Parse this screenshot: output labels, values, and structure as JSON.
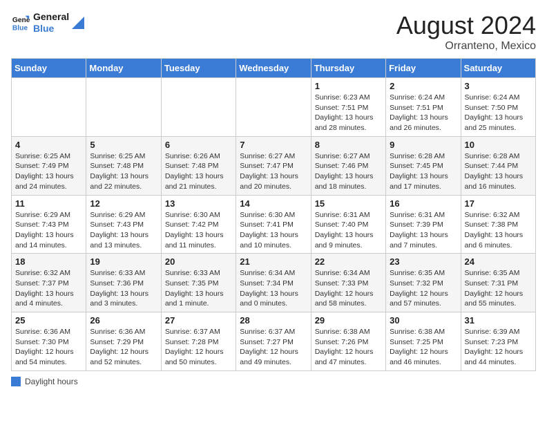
{
  "header": {
    "logo_general": "General",
    "logo_blue": "Blue",
    "month_year": "August 2024",
    "location": "Orranteno, Mexico"
  },
  "days_of_week": [
    "Sunday",
    "Monday",
    "Tuesday",
    "Wednesday",
    "Thursday",
    "Friday",
    "Saturday"
  ],
  "weeks": [
    {
      "days": [
        {
          "num": "",
          "info": ""
        },
        {
          "num": "",
          "info": ""
        },
        {
          "num": "",
          "info": ""
        },
        {
          "num": "",
          "info": ""
        },
        {
          "num": "1",
          "sunrise": "6:23 AM",
          "sunset": "7:51 PM",
          "daylight": "13 hours and 28 minutes."
        },
        {
          "num": "2",
          "sunrise": "6:24 AM",
          "sunset": "7:51 PM",
          "daylight": "13 hours and 26 minutes."
        },
        {
          "num": "3",
          "sunrise": "6:24 AM",
          "sunset": "7:50 PM",
          "daylight": "13 hours and 25 minutes."
        }
      ]
    },
    {
      "days": [
        {
          "num": "4",
          "sunrise": "6:25 AM",
          "sunset": "7:49 PM",
          "daylight": "13 hours and 24 minutes."
        },
        {
          "num": "5",
          "sunrise": "6:25 AM",
          "sunset": "7:48 PM",
          "daylight": "13 hours and 22 minutes."
        },
        {
          "num": "6",
          "sunrise": "6:26 AM",
          "sunset": "7:48 PM",
          "daylight": "13 hours and 21 minutes."
        },
        {
          "num": "7",
          "sunrise": "6:27 AM",
          "sunset": "7:47 PM",
          "daylight": "13 hours and 20 minutes."
        },
        {
          "num": "8",
          "sunrise": "6:27 AM",
          "sunset": "7:46 PM",
          "daylight": "13 hours and 18 minutes."
        },
        {
          "num": "9",
          "sunrise": "6:28 AM",
          "sunset": "7:45 PM",
          "daylight": "13 hours and 17 minutes."
        },
        {
          "num": "10",
          "sunrise": "6:28 AM",
          "sunset": "7:44 PM",
          "daylight": "13 hours and 16 minutes."
        }
      ]
    },
    {
      "days": [
        {
          "num": "11",
          "sunrise": "6:29 AM",
          "sunset": "7:43 PM",
          "daylight": "13 hours and 14 minutes."
        },
        {
          "num": "12",
          "sunrise": "6:29 AM",
          "sunset": "7:43 PM",
          "daylight": "13 hours and 13 minutes."
        },
        {
          "num": "13",
          "sunrise": "6:30 AM",
          "sunset": "7:42 PM",
          "daylight": "13 hours and 11 minutes."
        },
        {
          "num": "14",
          "sunrise": "6:30 AM",
          "sunset": "7:41 PM",
          "daylight": "13 hours and 10 minutes."
        },
        {
          "num": "15",
          "sunrise": "6:31 AM",
          "sunset": "7:40 PM",
          "daylight": "13 hours and 9 minutes."
        },
        {
          "num": "16",
          "sunrise": "6:31 AM",
          "sunset": "7:39 PM",
          "daylight": "13 hours and 7 minutes."
        },
        {
          "num": "17",
          "sunrise": "6:32 AM",
          "sunset": "7:38 PM",
          "daylight": "13 hours and 6 minutes."
        }
      ]
    },
    {
      "days": [
        {
          "num": "18",
          "sunrise": "6:32 AM",
          "sunset": "7:37 PM",
          "daylight": "13 hours and 4 minutes."
        },
        {
          "num": "19",
          "sunrise": "6:33 AM",
          "sunset": "7:36 PM",
          "daylight": "13 hours and 3 minutes."
        },
        {
          "num": "20",
          "sunrise": "6:33 AM",
          "sunset": "7:35 PM",
          "daylight": "13 hours and 1 minute."
        },
        {
          "num": "21",
          "sunrise": "6:34 AM",
          "sunset": "7:34 PM",
          "daylight": "13 hours and 0 minutes."
        },
        {
          "num": "22",
          "sunrise": "6:34 AM",
          "sunset": "7:33 PM",
          "daylight": "12 hours and 58 minutes."
        },
        {
          "num": "23",
          "sunrise": "6:35 AM",
          "sunset": "7:32 PM",
          "daylight": "12 hours and 57 minutes."
        },
        {
          "num": "24",
          "sunrise": "6:35 AM",
          "sunset": "7:31 PM",
          "daylight": "12 hours and 55 minutes."
        }
      ]
    },
    {
      "days": [
        {
          "num": "25",
          "sunrise": "6:36 AM",
          "sunset": "7:30 PM",
          "daylight": "12 hours and 54 minutes."
        },
        {
          "num": "26",
          "sunrise": "6:36 AM",
          "sunset": "7:29 PM",
          "daylight": "12 hours and 52 minutes."
        },
        {
          "num": "27",
          "sunrise": "6:37 AM",
          "sunset": "7:28 PM",
          "daylight": "12 hours and 50 minutes."
        },
        {
          "num": "28",
          "sunrise": "6:37 AM",
          "sunset": "7:27 PM",
          "daylight": "12 hours and 49 minutes."
        },
        {
          "num": "29",
          "sunrise": "6:38 AM",
          "sunset": "7:26 PM",
          "daylight": "12 hours and 47 minutes."
        },
        {
          "num": "30",
          "sunrise": "6:38 AM",
          "sunset": "7:25 PM",
          "daylight": "12 hours and 46 minutes."
        },
        {
          "num": "31",
          "sunrise": "6:39 AM",
          "sunset": "7:23 PM",
          "daylight": "12 hours and 44 minutes."
        }
      ]
    }
  ],
  "legend": {
    "label": "Daylight hours"
  }
}
